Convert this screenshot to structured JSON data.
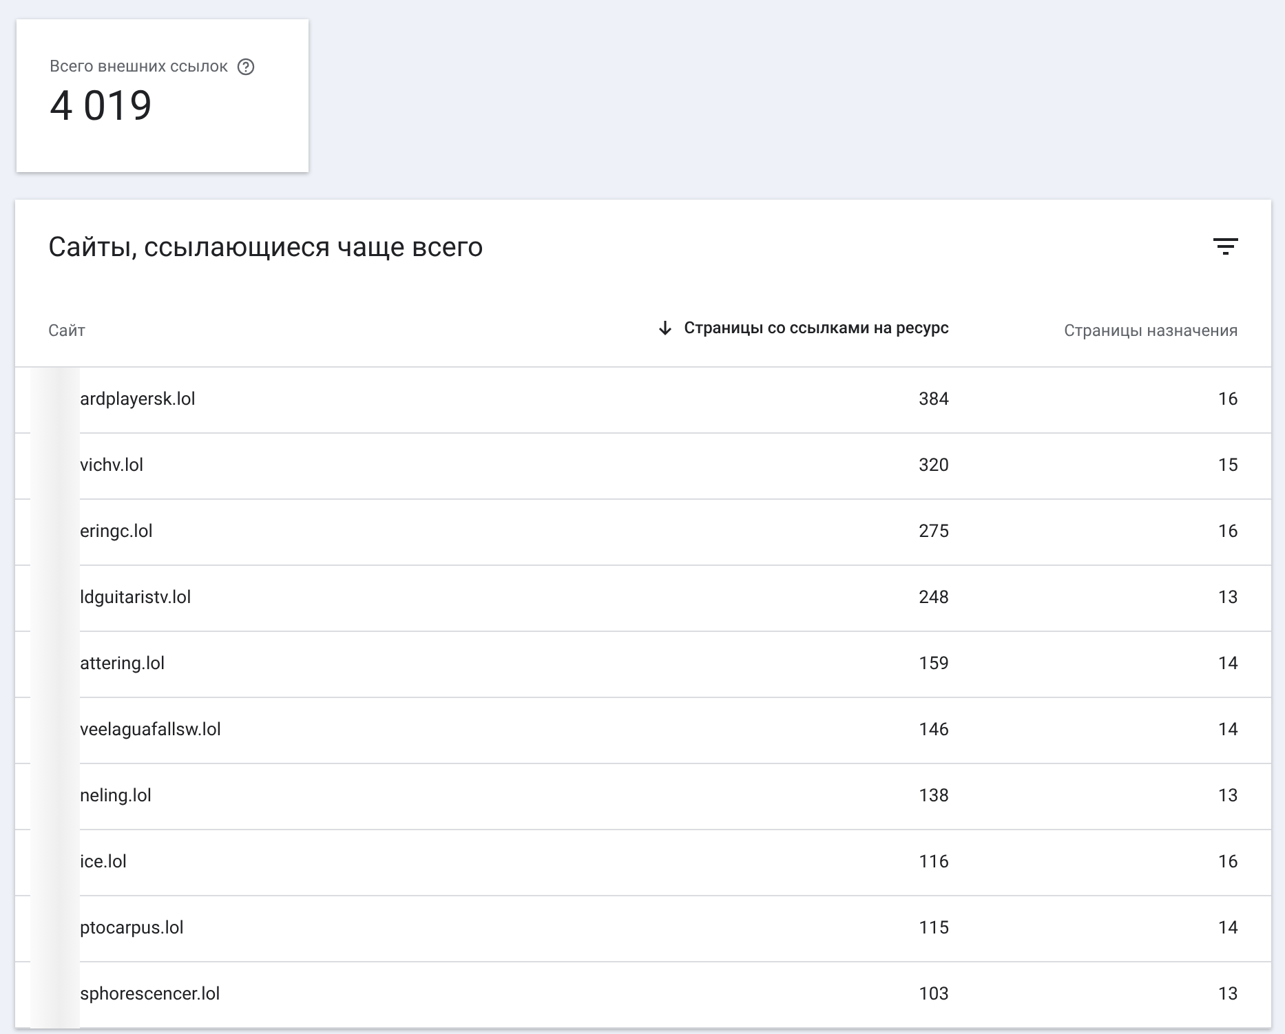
{
  "summary_card": {
    "label": "Всего внешних ссылок",
    "value": "4 019"
  },
  "table_card": {
    "title": "Сайты, ссылающиеся чаще всего",
    "columns": [
      {
        "label": "Сайт",
        "sorted": false
      },
      {
        "label": "Страницы со ссылками на ресурс",
        "sorted": true
      },
      {
        "label": "Страницы назначения",
        "sorted": false
      }
    ],
    "rows": [
      {
        "site": "ardplayersk.lol",
        "linking_pages": "384",
        "target_pages": "16"
      },
      {
        "site": "vichv.lol",
        "linking_pages": "320",
        "target_pages": "15"
      },
      {
        "site": "eringc.lol",
        "linking_pages": "275",
        "target_pages": "16"
      },
      {
        "site": "ldguitaristv.lol",
        "linking_pages": "248",
        "target_pages": "13"
      },
      {
        "site": "attering.lol",
        "linking_pages": "159",
        "target_pages": "14"
      },
      {
        "site": "veelaguafallsw.lol",
        "linking_pages": "146",
        "target_pages": "14"
      },
      {
        "site": "neling.lol",
        "linking_pages": "138",
        "target_pages": "13"
      },
      {
        "site": "ice.lol",
        "linking_pages": "116",
        "target_pages": "16"
      },
      {
        "site": "ptocarpus.lol",
        "linking_pages": "115",
        "target_pages": "14"
      },
      {
        "site": "sphorescencer.lol",
        "linking_pages": "103",
        "target_pages": "13"
      }
    ]
  }
}
